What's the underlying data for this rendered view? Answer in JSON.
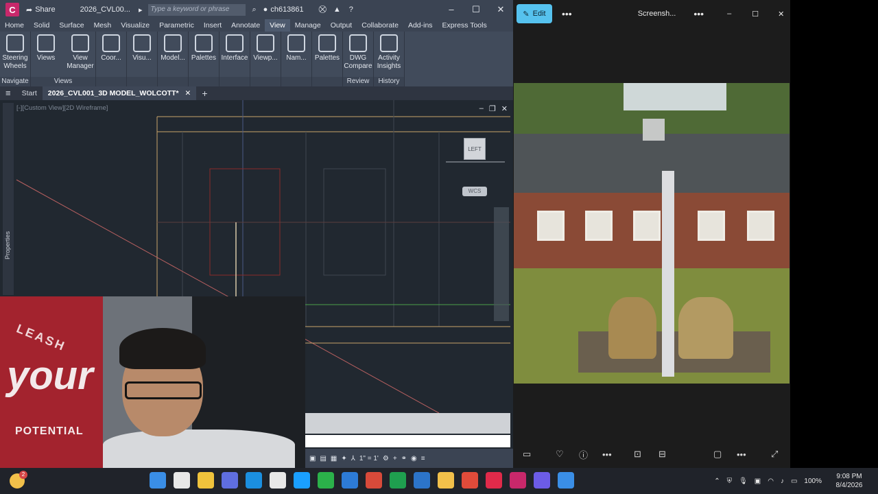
{
  "autocad": {
    "title": "2026_CVL00...",
    "share_label": "Share",
    "search_placeholder": "Type a keyword or phrase",
    "user": "ch613861",
    "tabs": [
      "Home",
      "Solid",
      "Surface",
      "Mesh",
      "Visualize",
      "Parametric",
      "Insert",
      "Annotate",
      "View",
      "Manage",
      "Output",
      "Collaborate",
      "Add-ins",
      "Express Tools"
    ],
    "active_tab": "View",
    "ribbon": {
      "groups": [
        {
          "title": "Navigate",
          "buttons": [
            "Steering Wheels"
          ]
        },
        {
          "title": "Views",
          "buttons": [
            "Views",
            "View Manager"
          ]
        },
        {
          "title": "",
          "buttons": [
            "Coor..."
          ]
        },
        {
          "title": "",
          "buttons": [
            "Visu..."
          ]
        },
        {
          "title": "",
          "buttons": [
            "Model..."
          ]
        },
        {
          "title": "",
          "buttons": [
            "Palettes"
          ]
        },
        {
          "title": "",
          "buttons": [
            "Interface"
          ]
        },
        {
          "title": "",
          "buttons": [
            "Viewp..."
          ]
        },
        {
          "title": "",
          "buttons": [
            "Nam..."
          ]
        },
        {
          "title": "",
          "buttons": [
            "Palettes"
          ]
        },
        {
          "title": "Review",
          "buttons": [
            "DWG Compare"
          ]
        },
        {
          "title": "History",
          "buttons": [
            "Activity Insights"
          ]
        }
      ]
    },
    "doc_tabs": {
      "start": "Start",
      "active": "2026_CVL001_3D MODEL_WOLCOTT*"
    },
    "viewport_label": "[-][Custom View][2D Wireframe]",
    "properties_label": "Properties",
    "viewcube_label": "LEFT",
    "wcs_label": "WCS",
    "scale": "1\" = 1'"
  },
  "webcam": {
    "wall_text_1": "LEASH",
    "wall_text_2": "your",
    "wall_text_3": "POTENTIAL"
  },
  "photos": {
    "edit_label": "Edit",
    "title": "Screensh..."
  },
  "taskbar": {
    "badge_count": "2",
    "battery": "100%",
    "time": "9:08 PM",
    "date": "8/4/2026",
    "app_colors": [
      "#3a8ee6",
      "#e8e8e8",
      "#f0c33c",
      "#5f6ee0",
      "#1b8fe0",
      "#e8e8e8",
      "#1a9fff",
      "#2bb14a",
      "#2d7bd6",
      "#d84a3a",
      "#1f9f4f",
      "#2c74c9",
      "#f2c04a",
      "#e04b3a",
      "#e02a4a",
      "#c8286b",
      "#6c5ce7",
      "#3a8ee6"
    ]
  }
}
